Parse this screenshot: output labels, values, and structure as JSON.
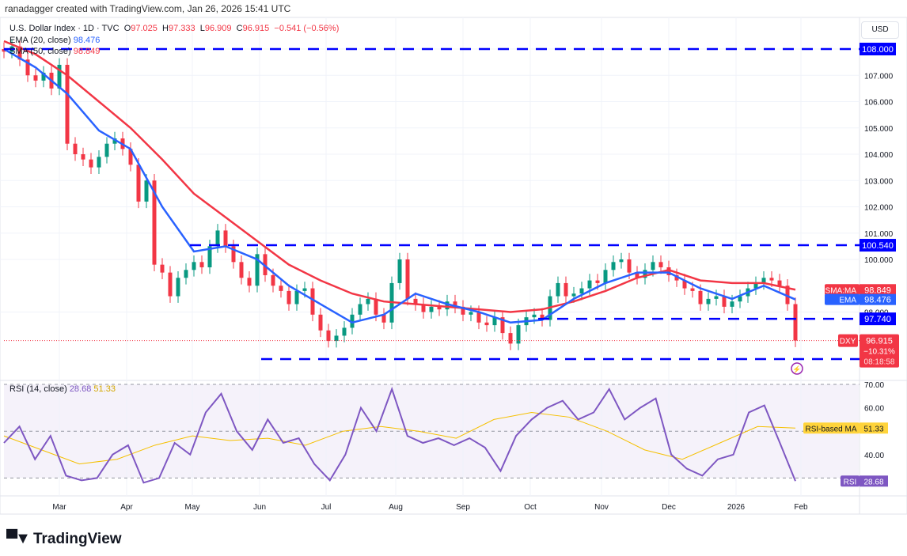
{
  "credit": "ranadagger created with TradingView.com, Jan 26, 2026 15:41 UTC",
  "legend": {
    "symbol": "U.S. Dollar Index · 1D · TVC",
    "o_label": "O",
    "o": "97.025",
    "h_label": "H",
    "h": "97.333",
    "l_label": "L",
    "l": "96.909",
    "c_label": "C",
    "c": "96.915",
    "change": "−0.541 (−0.56%)",
    "ema_label": "EMA (20, close)",
    "ema": "98.476",
    "sma_label": "SMA (50, close)",
    "sma": "98.849",
    "rsi_label": "RSI (14, close)",
    "rsi": "28.68",
    "rsi_ma": "51.33"
  },
  "currency": "USD",
  "logo": "TradingView",
  "colors": {
    "up": "#089981",
    "down": "#f23645",
    "ema": "#2962ff",
    "sma": "#f23645",
    "rsi": "#7e57c2",
    "rsi_ma": "#f5c000",
    "levels": "#0000ff"
  },
  "chart_data": {
    "type": "candlestick",
    "period": "2025-02 to 2026-01-26",
    "ylim": [
      95.6,
      108.3
    ],
    "y_ticks": [
      "108.000",
      "107.000",
      "106.000",
      "105.000",
      "104.000",
      "103.000",
      "102.000",
      "101.000",
      "100.000",
      "98.000"
    ],
    "x_ticks": [
      "Mar",
      "Apr",
      "May",
      "Jun",
      "Jul",
      "Aug",
      "Sep",
      "Oct",
      "Nov",
      "Dec",
      "2026",
      "Feb"
    ],
    "close": [
      107.9,
      108.1,
      107.6,
      107.0,
      106.8,
      107.1,
      106.5,
      107.4,
      104.4,
      104.0,
      103.8,
      103.5,
      103.9,
      104.4,
      104.6,
      104.2,
      103.6,
      102.2,
      103.0,
      99.8,
      99.5,
      98.6,
      99.3,
      99.6,
      99.9,
      99.7,
      100.5,
      101.1,
      100.5,
      99.9,
      99.3,
      99.0,
      100.2,
      99.4,
      99.0,
      98.8,
      98.3,
      98.8,
      98.9,
      97.9,
      97.3,
      96.9,
      97.1,
      97.4,
      97.9,
      98.3,
      98.5,
      97.9,
      97.6,
      99.1,
      100.0,
      98.5,
      98.3,
      98.0,
      98.2,
      98.1,
      98.4,
      98.2,
      97.9,
      98.0,
      97.6,
      97.5,
      97.8,
      97.2,
      96.8,
      97.5,
      97.8,
      97.9,
      97.7,
      98.6,
      99.1,
      98.6,
      98.7,
      98.9,
      99.2,
      99.1,
      99.6,
      99.9,
      100.0,
      99.5,
      99.3,
      99.6,
      99.9,
      99.7,
      99.4,
      99.2,
      98.9,
      98.8,
      98.3,
      98.5,
      98.6,
      98.2,
      98.4,
      98.6,
      98.9,
      99.1,
      99.3,
      99.2,
      99.0,
      98.3,
      96.915
    ],
    "ema20": [
      108.0,
      107.3,
      106.3,
      104.9,
      104.2,
      102.0,
      100.3,
      100.5,
      100.0,
      99.0,
      98.3,
      97.6,
      97.9,
      98.7,
      98.3,
      98.0,
      97.6,
      97.7,
      98.5,
      99.1,
      99.5,
      99.5,
      98.9,
      98.5,
      99.0,
      98.476
    ],
    "sma50": [
      108.3,
      107.8,
      107.0,
      106.0,
      105.0,
      103.8,
      102.5,
      101.6,
      100.7,
      99.8,
      99.2,
      98.7,
      98.4,
      98.3,
      98.2,
      98.1,
      98.0,
      98.1,
      98.4,
      98.8,
      99.3,
      99.6,
      99.2,
      99.1,
      99.1,
      98.849
    ],
    "levels": [
      {
        "value": 108.0,
        "label": "108.000"
      },
      {
        "value": 100.54,
        "label": "100.540"
      },
      {
        "value": 97.74,
        "label": "97.740"
      },
      {
        "value": 96.21,
        "label": "96.210"
      }
    ],
    "last": {
      "symbol": "DXY",
      "price": "96.915",
      "change_pct": "−10.31%",
      "countdown": "08:18:58"
    },
    "ma_tags": {
      "sma": "SMA:MA",
      "sma_value": "98.849",
      "ema": "EMA",
      "ema_value": "98.476"
    },
    "rsi": {
      "ylim": [
        20,
        73
      ],
      "ticks": [
        "70.00",
        "60.00",
        "40.00"
      ],
      "levels": [
        70,
        50,
        30
      ],
      "values": [
        45,
        52,
        38,
        48,
        31,
        29,
        30,
        40,
        44,
        28,
        30,
        45,
        40,
        58,
        66,
        50,
        42,
        55,
        45,
        47,
        36,
        29,
        40,
        60,
        50,
        68,
        48,
        45,
        47,
        44,
        47,
        43,
        33,
        48,
        55,
        60,
        63,
        55,
        58,
        68,
        55,
        60,
        64,
        40,
        34,
        31,
        38,
        40,
        58,
        61,
        45,
        28.68
      ],
      "ma": [
        48,
        42,
        36,
        38,
        44,
        48,
        46,
        47,
        44,
        50,
        52,
        50,
        47,
        55,
        58,
        56,
        50,
        42,
        38,
        45,
        52,
        51.33
      ],
      "ma_tag": "RSI-based MA",
      "ma_value": "51.33",
      "rsi_tag": "RSI",
      "rsi_value": "28.68"
    }
  }
}
